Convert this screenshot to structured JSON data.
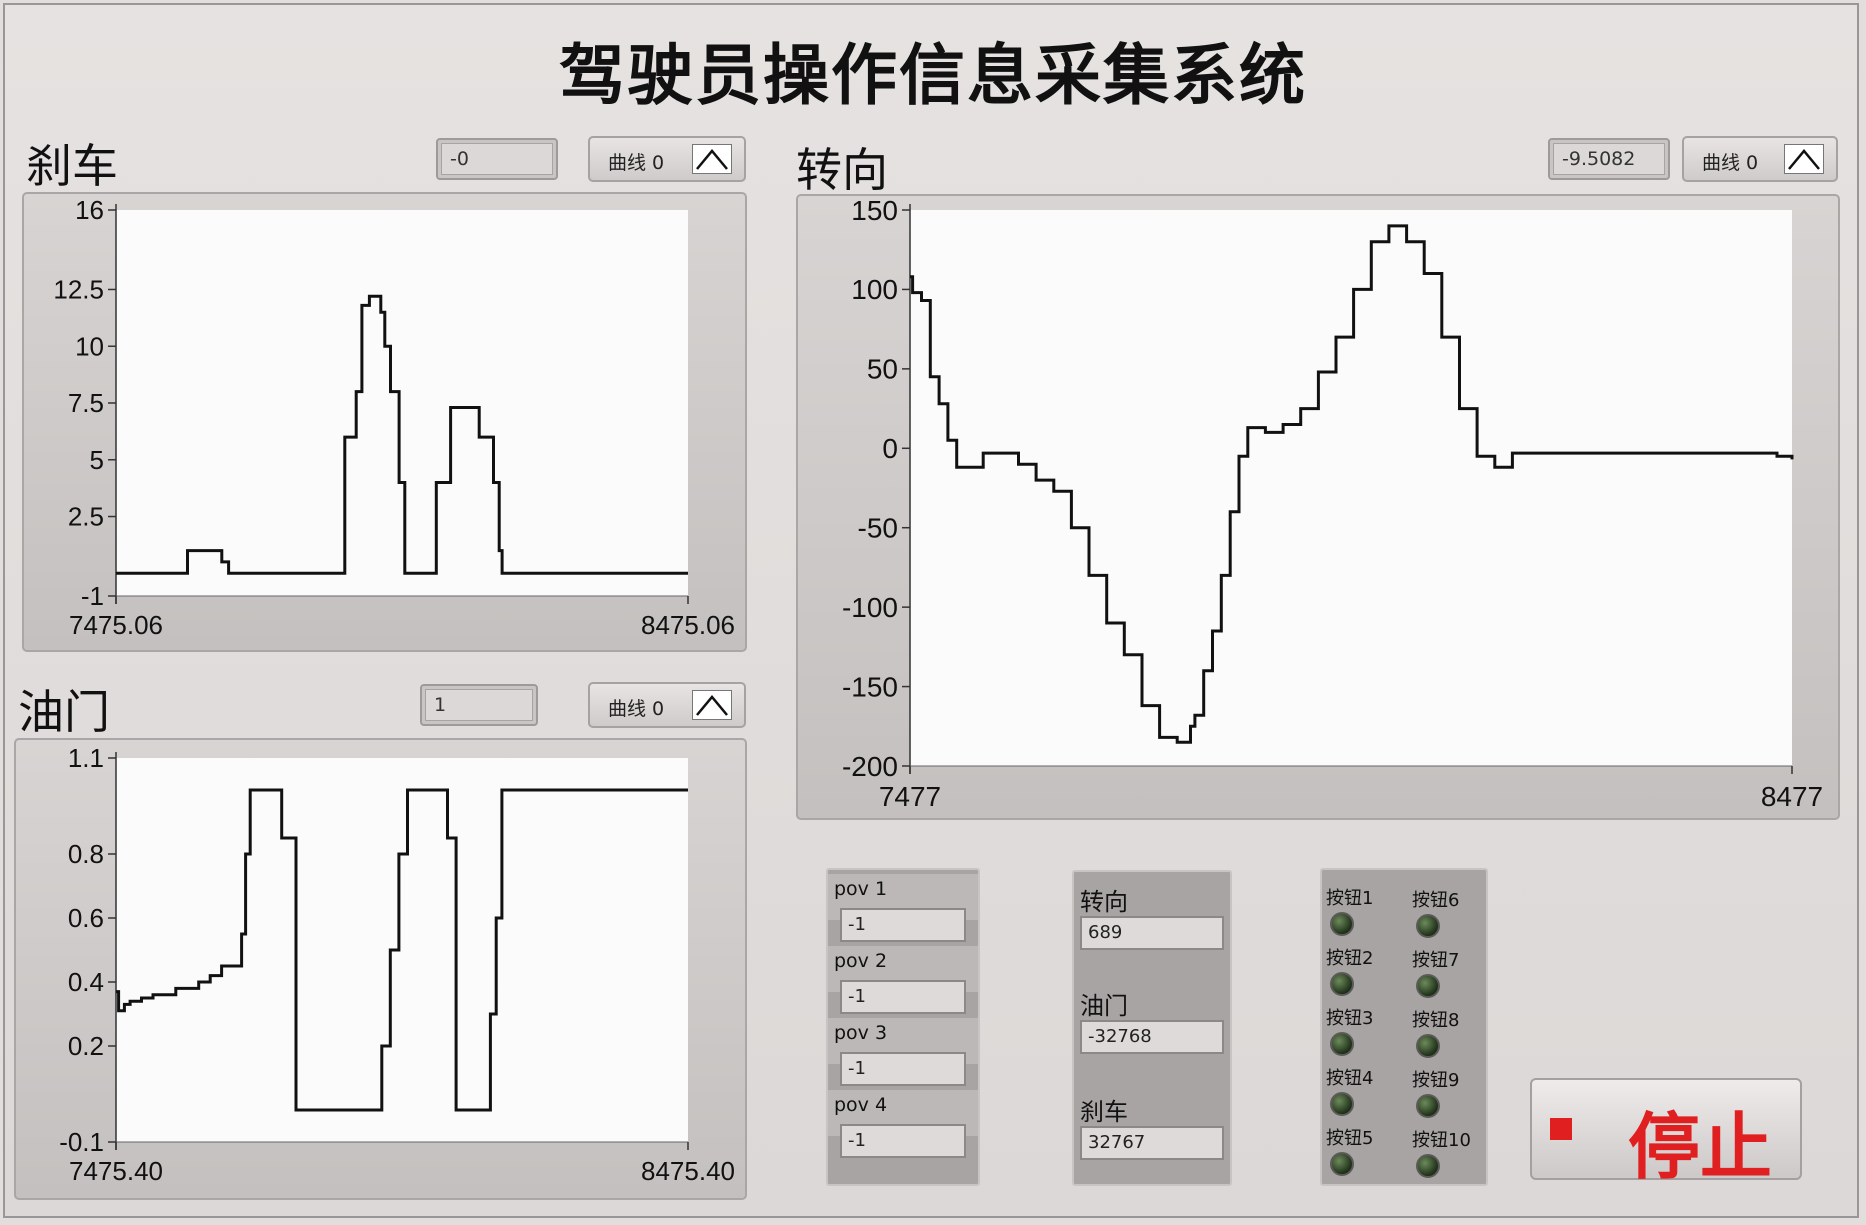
{
  "window": {
    "title": "驾驶员操作信息采集系统"
  },
  "brake": {
    "title": "刹车",
    "indicator_value": "-0",
    "legend_label": "曲线 0",
    "chart_data": {
      "type": "line",
      "ylim": [
        -1,
        16
      ],
      "yticks": [
        "16",
        "12.5",
        "10",
        "7.5",
        "5",
        "2.5",
        "-1"
      ],
      "xticks": [
        "7475.06",
        "8475.06"
      ],
      "xlim": [
        7475.06,
        8475.06
      ],
      "x": [
        7475.06,
        7590,
        7600,
        7650,
        7660,
        7672,
        7800,
        7865,
        7875,
        7895,
        7905,
        7918,
        7938,
        7945,
        7955,
        7970,
        7980,
        8000,
        8025,
        8035,
        8060,
        8085,
        8095,
        8110,
        8135,
        8145,
        8150,
        8475.06
      ],
      "y": [
        0,
        0,
        1,
        1,
        0.5,
        0,
        0,
        0,
        6,
        8,
        11.8,
        12.2,
        11.5,
        10,
        8,
        4,
        0,
        0,
        0,
        4,
        7.3,
        7.3,
        7.3,
        6,
        4,
        1,
        0,
        0
      ]
    }
  },
  "throttle": {
    "title": "油门",
    "indicator_value": "1",
    "legend_label": "曲线 0",
    "chart_data": {
      "type": "line",
      "ylim": [
        -0.1,
        1.1
      ],
      "yticks": [
        "1.1",
        "0.8",
        "0.6",
        "0.4",
        "0.2",
        "-0.1"
      ],
      "xticks": [
        "7475.40",
        "8475.40"
      ],
      "xlim": [
        7475.4,
        8475.4
      ],
      "x": [
        7475.4,
        7480,
        7490,
        7500,
        7520,
        7540,
        7560,
        7580,
        7600,
        7620,
        7640,
        7660,
        7685,
        7695,
        7702,
        7710,
        7755,
        7765,
        7790,
        7800,
        7930,
        7940,
        7955,
        7970,
        7985,
        8000,
        8045,
        8055,
        8070,
        8100,
        8115,
        8130,
        8140,
        8150,
        8475.4
      ],
      "y": [
        0.37,
        0.31,
        0.33,
        0.34,
        0.35,
        0.36,
        0.36,
        0.38,
        0.38,
        0.4,
        0.42,
        0.45,
        0.45,
        0.55,
        0.8,
        1.0,
        1.0,
        0.85,
        0.0,
        0.0,
        0.0,
        0.2,
        0.5,
        0.8,
        1.0,
        1.0,
        1.0,
        0.85,
        0.0,
        0.0,
        0.0,
        0.3,
        0.6,
        1.0,
        1.0
      ]
    }
  },
  "steering": {
    "title": "转向",
    "indicator_value": "-9.5082",
    "legend_label": "曲线 0",
    "chart_data": {
      "type": "line",
      "ylim": [
        -200,
        150
      ],
      "yticks": [
        "150",
        "100",
        "50",
        "0",
        "-50",
        "-100",
        "-150",
        "-200"
      ],
      "xticks": [
        "7477",
        "8477"
      ],
      "xlim": [
        7477,
        8477
      ],
      "x": [
        7477,
        7480,
        7490,
        7500,
        7510,
        7520,
        7530,
        7545,
        7560,
        7580,
        7600,
        7620,
        7640,
        7660,
        7680,
        7700,
        7720,
        7740,
        7760,
        7780,
        7795,
        7800,
        7810,
        7820,
        7830,
        7840,
        7850,
        7860,
        7880,
        7900,
        7920,
        7940,
        7960,
        7980,
        8000,
        8020,
        8040,
        8060,
        8080,
        8100,
        8120,
        8140,
        8160,
        8180,
        8200,
        8220,
        8240,
        8260,
        8280,
        8300,
        8320,
        8340,
        8360,
        8380,
        8400,
        8420,
        8440,
        8460,
        8477
      ],
      "y": [
        108,
        98,
        93,
        45,
        28,
        5,
        -12,
        -12,
        -3,
        -3,
        -10,
        -20,
        -27,
        -50,
        -80,
        -110,
        -130,
        -162,
        -182,
        -185,
        -175,
        -168,
        -140,
        -115,
        -80,
        -40,
        -5,
        13,
        10,
        15,
        25,
        48,
        70,
        100,
        130,
        140,
        130,
        110,
        70,
        25,
        -5,
        -12,
        -3,
        -3,
        -3,
        -3,
        -3,
        -3,
        -3,
        -3,
        -3,
        -3,
        -3,
        -3,
        -3,
        -3,
        -3,
        -5,
        -7
      ]
    }
  },
  "pov_cluster": {
    "items": [
      {
        "label": "pov 1",
        "value": "-1"
      },
      {
        "label": "pov 2",
        "value": "-1"
      },
      {
        "label": "pov 3",
        "value": "-1"
      },
      {
        "label": "pov 4",
        "value": "-1"
      }
    ]
  },
  "raw_cluster": {
    "items": [
      {
        "label": "转向",
        "value": "689"
      },
      {
        "label": "油门",
        "value": "-32768"
      },
      {
        "label": "刹车",
        "value": "32767"
      }
    ]
  },
  "buttons": {
    "left": [
      "按钮1",
      "按钮2",
      "按钮3",
      "按钮4",
      "按钮5"
    ],
    "right": [
      "按钮6",
      "按钮7",
      "按钮8",
      "按钮9",
      "按钮10"
    ]
  },
  "stop_button": {
    "label": "停止",
    "color": "#e02020"
  }
}
